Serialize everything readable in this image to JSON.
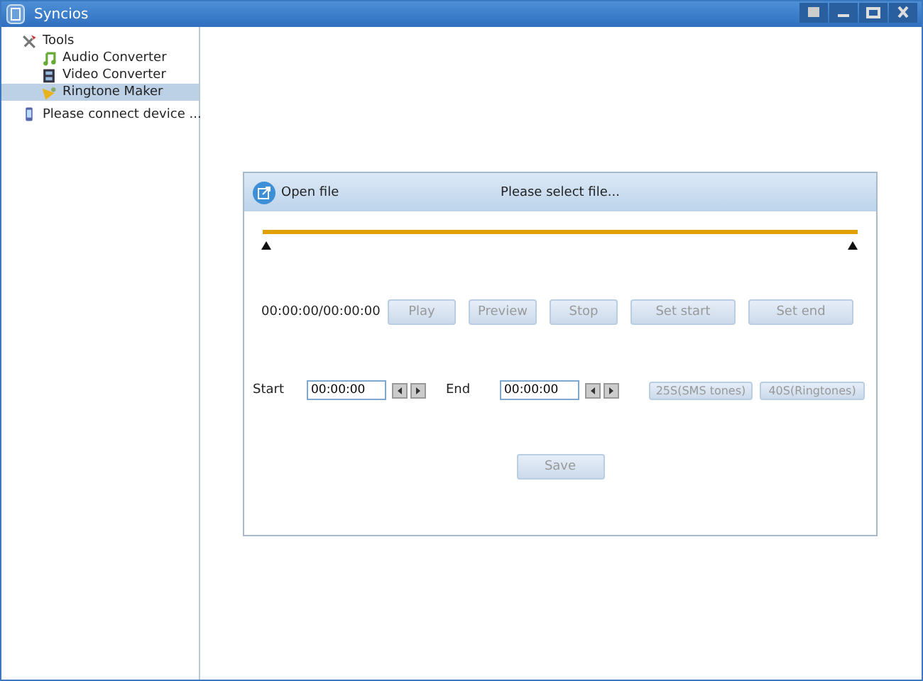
{
  "window": {
    "title": "Syncios"
  },
  "sidebar": {
    "items": [
      {
        "label": "Tools",
        "kind": "group",
        "selected": false,
        "children": [
          {
            "label": "Audio Converter",
            "kind": "audio",
            "selected": false
          },
          {
            "label": "Video Converter",
            "kind": "video",
            "selected": false
          },
          {
            "label": "Ringtone Maker",
            "kind": "ringtone",
            "selected": true
          }
        ]
      },
      {
        "label": "Please connect device ...",
        "kind": "device",
        "selected": false
      }
    ]
  },
  "panel": {
    "open_label": "Open file",
    "status": "Please select file...",
    "time": "00:00:00/00:00:00",
    "controls": [
      {
        "label": "Play",
        "disabled": true
      },
      {
        "label": "Preview",
        "disabled": true
      },
      {
        "label": "Stop",
        "disabled": true
      },
      {
        "label": "Set start",
        "disabled": true
      },
      {
        "label": "Set end",
        "disabled": true
      }
    ],
    "start_label": "Start",
    "start_value": "00:00:00",
    "end_label": "End",
    "end_value": "00:00:00",
    "presets": [
      {
        "label": "25S(SMS tones)",
        "disabled": true
      },
      {
        "label": "40S(Ringtones)",
        "disabled": true
      }
    ],
    "save": {
      "label": "Save",
      "disabled": true
    }
  }
}
